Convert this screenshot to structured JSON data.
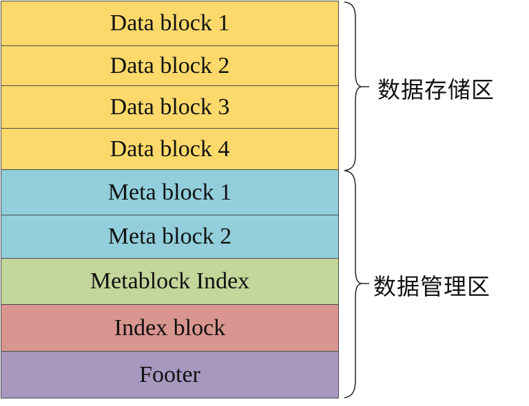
{
  "blocks": [
    {
      "label": "Data block 1",
      "color": "#fdd96b"
    },
    {
      "label": "Data block 2",
      "color": "#fdd96b"
    },
    {
      "label": "Data block 3",
      "color": "#fdd96b"
    },
    {
      "label": "Data block 4",
      "color": "#fdd96b"
    },
    {
      "label": "Meta block 1",
      "color": "#92cedb"
    },
    {
      "label": "Meta block 2",
      "color": "#92cedb"
    },
    {
      "label": "Metablock Index",
      "color": "#c3d69b"
    },
    {
      "label": "Index block",
      "color": "#d9958f"
    },
    {
      "label": "Footer",
      "color": "#a898c0"
    }
  ],
  "regions": {
    "data_storage": "数据存储区",
    "data_management": "数据管理区"
  }
}
